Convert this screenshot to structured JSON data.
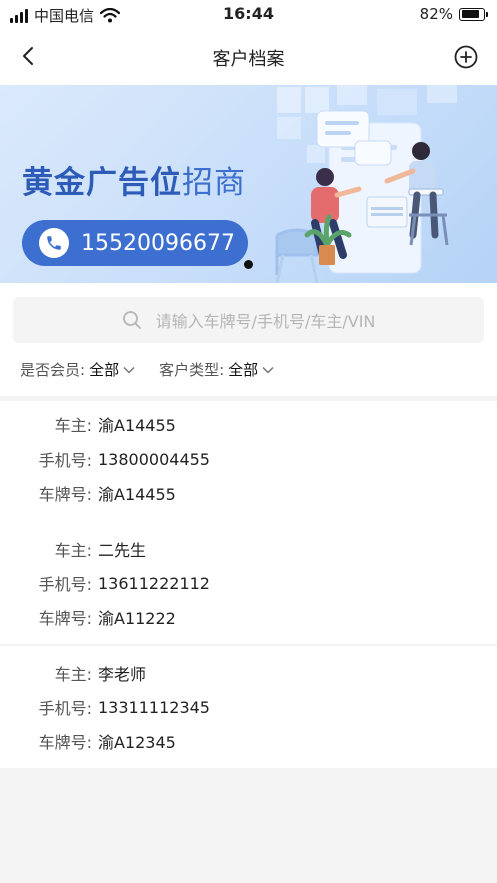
{
  "status_bar": {
    "carrier": "中国电信",
    "time": "16:44",
    "battery_percent": "82%",
    "battery_level": 0.82
  },
  "nav": {
    "title": "客户档案"
  },
  "banner": {
    "title_bold": "黄金广告位",
    "title_light": "招商",
    "phone": "15520096677"
  },
  "search": {
    "placeholder": "请输入车牌号/手机号/车主/VIN"
  },
  "filters": [
    {
      "label": "是否会员:",
      "value": "全部"
    },
    {
      "label": "客户类型:",
      "value": "全部"
    }
  ],
  "customers": [
    {
      "owner_label": "车主:",
      "owner": "渝A14455",
      "phone_label": "手机号:",
      "phone": "13800004455",
      "plate_label": "车牌号:",
      "plate": "渝A14455"
    },
    {
      "owner_label": "车主:",
      "owner": "二先生",
      "phone_label": "手机号:",
      "phone": "13611222112",
      "plate_label": "车牌号:",
      "plate": "渝A11222"
    },
    {
      "owner_label": "车主:",
      "owner": "李老师",
      "phone_label": "手机号:",
      "phone": "13311112345",
      "plate_label": "车牌号:",
      "plate": "渝A12345"
    }
  ]
}
